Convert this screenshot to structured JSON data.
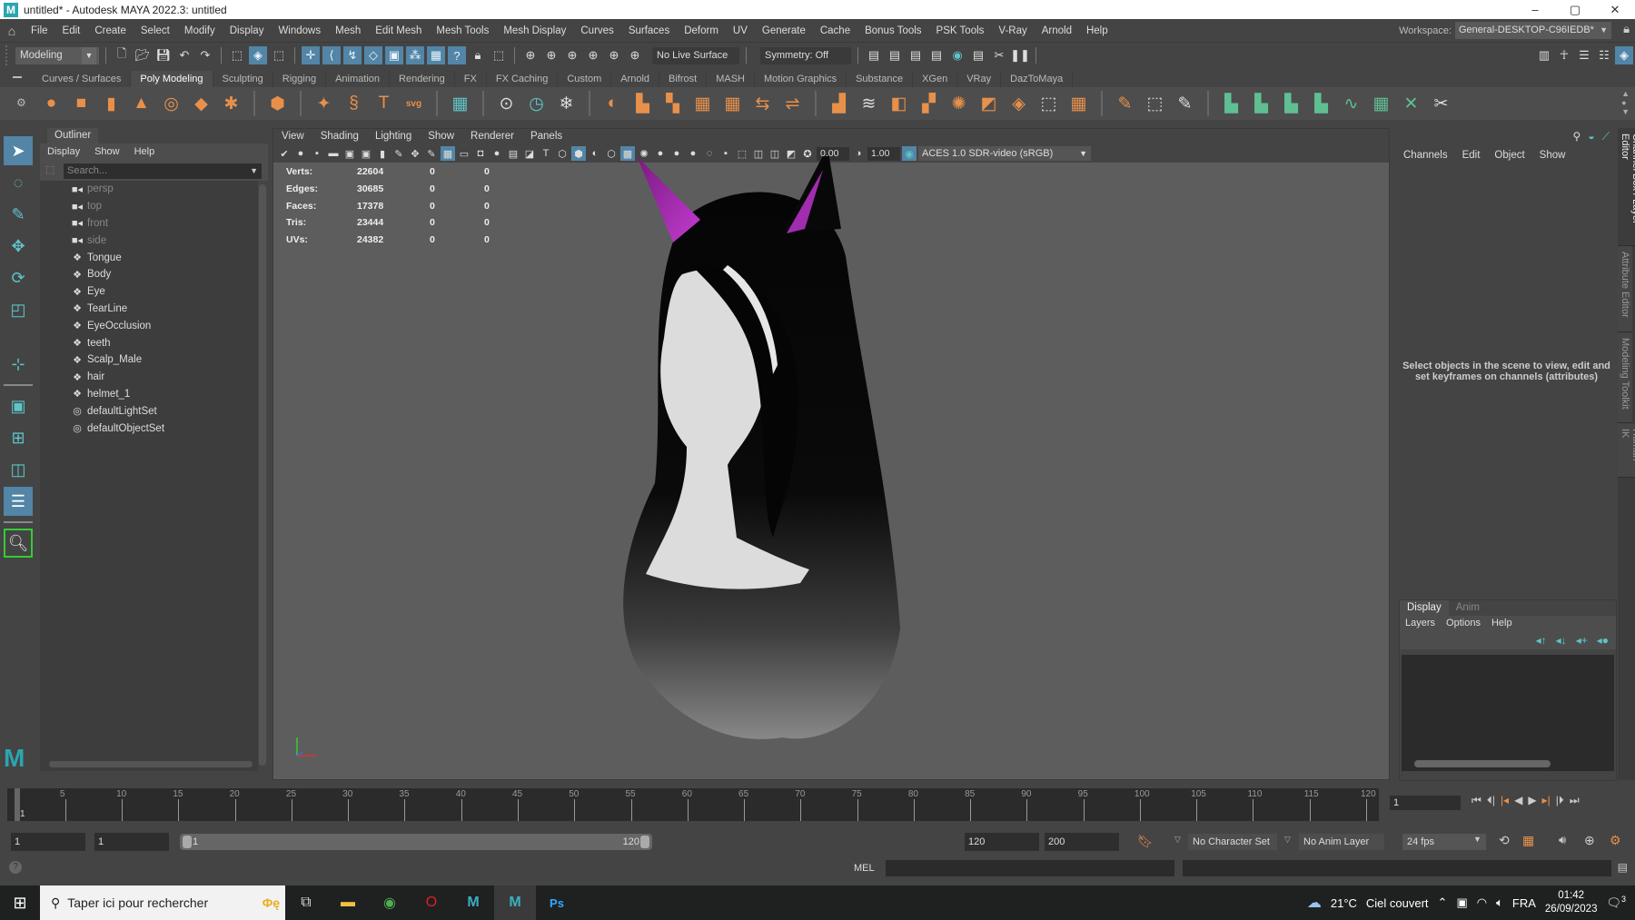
{
  "window": {
    "title": "untitled* - Autodesk MAYA 2022.3: untitled",
    "controls": [
      "–",
      "▢",
      "✕"
    ]
  },
  "menubar": {
    "items": [
      "File",
      "Edit",
      "Create",
      "Select",
      "Modify",
      "Display",
      "Windows",
      "Mesh",
      "Edit Mesh",
      "Mesh Tools",
      "Mesh Display",
      "Curves",
      "Surfaces",
      "Deform",
      "UV",
      "Generate",
      "Cache",
      "Bonus Tools",
      "PSK Tools",
      "V-Ray",
      "Arnold",
      "Help"
    ],
    "workspace_label": "Workspace:",
    "workspace_value": "General-DESKTOP-C96IEDB*"
  },
  "statusline": {
    "mode": "Modeling",
    "live_surface": "No Live Surface",
    "symmetry": "Symmetry: Off"
  },
  "shelf": {
    "tabs": [
      "Curves / Surfaces",
      "Poly Modeling",
      "Sculpting",
      "Rigging",
      "Animation",
      "Rendering",
      "FX",
      "FX Caching",
      "Custom",
      "Arnold",
      "Bifrost",
      "MASH",
      "Motion Graphics",
      "Substance",
      "XGen",
      "VRay",
      "DazToMaya"
    ],
    "active_tab": "Poly Modeling"
  },
  "outliner": {
    "title": "Outliner",
    "menu": [
      "Display",
      "Show",
      "Help"
    ],
    "search_placeholder": "Search...",
    "items": [
      {
        "name": "persp",
        "type": "camera",
        "dim": true
      },
      {
        "name": "top",
        "type": "camera",
        "dim": true
      },
      {
        "name": "front",
        "type": "camera",
        "dim": true
      },
      {
        "name": "side",
        "type": "camera",
        "dim": true
      },
      {
        "name": "Tongue",
        "type": "mesh",
        "dim": false
      },
      {
        "name": "Body",
        "type": "mesh",
        "dim": false
      },
      {
        "name": "Eye",
        "type": "mesh",
        "dim": false
      },
      {
        "name": "TearLine",
        "type": "mesh",
        "dim": false
      },
      {
        "name": "EyeOcclusion",
        "type": "mesh",
        "dim": false
      },
      {
        "name": "teeth",
        "type": "mesh",
        "dim": false
      },
      {
        "name": "Scalp_Male",
        "type": "mesh",
        "dim": false
      },
      {
        "name": "hair",
        "type": "mesh",
        "dim": false
      },
      {
        "name": "helmet_1",
        "type": "mesh",
        "dim": false
      },
      {
        "name": "defaultLightSet",
        "type": "set",
        "dim": false
      },
      {
        "name": "defaultObjectSet",
        "type": "set",
        "dim": false
      }
    ]
  },
  "viewport": {
    "menu": [
      "View",
      "Shading",
      "Lighting",
      "Show",
      "Renderer",
      "Panels"
    ],
    "exposure": "0.00",
    "gamma": "1.00",
    "color_mgmt": "ACES 1.0 SDR-video (sRGB)",
    "hud": [
      {
        "label": "Verts:",
        "v1": "22604",
        "v2": "0",
        "v3": "0"
      },
      {
        "label": "Edges:",
        "v1": "30685",
        "v2": "0",
        "v3": "0"
      },
      {
        "label": "Faces:",
        "v1": "17378",
        "v2": "0",
        "v3": "0"
      },
      {
        "label": "Tris:",
        "v1": "23444",
        "v2": "0",
        "v3": "0"
      },
      {
        "label": "UVs:",
        "v1": "24382",
        "v2": "0",
        "v3": "0"
      }
    ]
  },
  "channelbox": {
    "menu": [
      "Channels",
      "Edit",
      "Object",
      "Show"
    ],
    "message": "Select objects in the scene to view, edit and set keyframes on channels (attributes)"
  },
  "layer_editor": {
    "tabs": [
      "Display",
      "Anim"
    ],
    "active_tab": "Display",
    "menu": [
      "Layers",
      "Options",
      "Help"
    ]
  },
  "side_tabs": [
    "Channel Box / Layer Editor",
    "Attribute Editor",
    "Modeling Toolkit",
    "Human IK"
  ],
  "timeline": {
    "ticks": [
      5,
      10,
      15,
      20,
      25,
      30,
      35,
      40,
      45,
      50,
      55,
      60,
      65,
      70,
      75,
      80,
      85,
      90,
      95,
      100,
      105,
      110,
      115,
      120
    ],
    "start": 1,
    "end": 120,
    "current_frame": "1",
    "current_label": "1"
  },
  "range": {
    "anim_start": "1",
    "playback_start": "1",
    "range_start_label": "1",
    "range_end_label": "120",
    "playback_end": "120",
    "anim_end": "200",
    "character_set": "No Character Set",
    "anim_layer": "No Anim Layer",
    "fps": "24 fps"
  },
  "cmdline": {
    "language": "MEL"
  },
  "taskbar": {
    "search_placeholder": "Taper ici pour rechercher",
    "weather_temp": "21°C",
    "weather_desc": "Ciel couvert",
    "language": "FRA",
    "time": "01:42",
    "date": "26/09/2023",
    "notifications": "3"
  }
}
